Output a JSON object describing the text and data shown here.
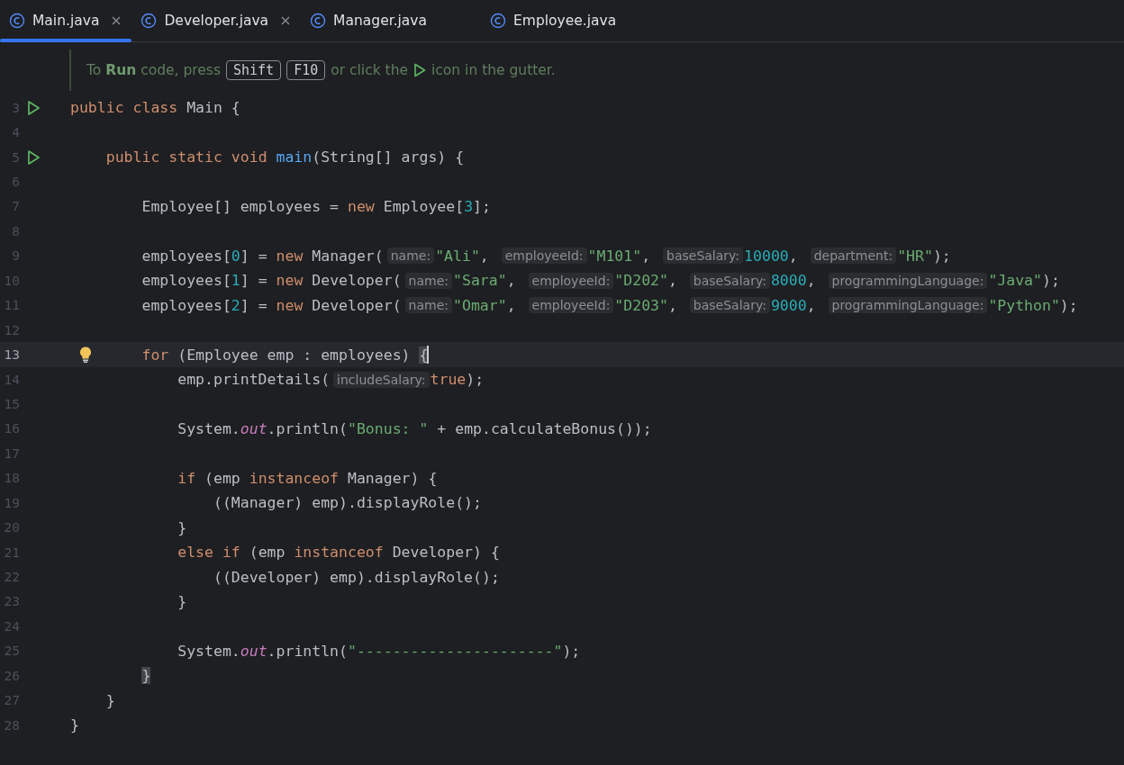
{
  "tabs": [
    {
      "label": "Main.java",
      "selected": true,
      "closable": true
    },
    {
      "label": "Developer.java",
      "selected": false,
      "closable": true
    },
    {
      "label": "Manager.java",
      "selected": false,
      "closable": false
    },
    {
      "label": "Employee.java",
      "selected": false,
      "closable": false
    }
  ],
  "run_hint": {
    "before": "To **Run** code, press",
    "keys": [
      "Shift",
      "F10"
    ],
    "middle": "or click the",
    "after": "icon in the gutter."
  },
  "lines": [
    {
      "number": "3",
      "kind": "run",
      "current": false,
      "segments": [
        {
          "kind": "keyword",
          "text": "public class"
        },
        {
          "kind": "plain",
          "text": " Main {"
        }
      ]
    },
    {
      "number": "4",
      "kind": "plain",
      "current": false
    },
    {
      "number": "5",
      "kind": "run",
      "current": false,
      "segments": [
        {
          "kind": "keyword",
          "text": "    public static void "
        },
        {
          "kind": "method",
          "text": "main"
        },
        {
          "kind": "plain",
          "text": "(String[] args) {"
        }
      ]
    },
    {
      "number": "6",
      "kind": "plain",
      "current": false
    },
    {
      "number": "7",
      "kind": "plain",
      "current": false,
      "segments": [
        {
          "kind": "plain",
          "text": "        Employee[] employees = "
        },
        {
          "kind": "keyword",
          "text": "new"
        },
        {
          "kind": "plain",
          "text": " Employee["
        },
        {
          "kind": "number",
          "text": "3"
        },
        {
          "kind": "plain",
          "text": "];"
        }
      ]
    },
    {
      "number": "8",
      "kind": "plain",
      "current": false
    },
    {
      "number": "9",
      "kind": "plain",
      "current": false,
      "segments": [
        {
          "kind": "plain",
          "text": "        employees["
        },
        {
          "kind": "number",
          "text": "0"
        },
        {
          "kind": "plain",
          "text": "] = "
        },
        {
          "kind": "keyword",
          "text": "new"
        },
        {
          "kind": "plain",
          "text": " Manager("
        },
        {
          "kind": "hint",
          "text": "name:"
        },
        {
          "kind": "string",
          "text": "\"Ali\""
        },
        {
          "kind": "plain",
          "text": ", "
        },
        {
          "kind": "hint",
          "text": "employeeId:"
        },
        {
          "kind": "string",
          "text": "\"M101\""
        },
        {
          "kind": "plain",
          "text": ", "
        },
        {
          "kind": "hint",
          "text": "baseSalary:"
        },
        {
          "kind": "number",
          "text": "10000"
        },
        {
          "kind": "plain",
          "text": ", "
        },
        {
          "kind": "hint",
          "text": "department:"
        },
        {
          "kind": "string",
          "text": "\"HR\""
        },
        {
          "kind": "plain",
          "text": ");"
        }
      ]
    },
    {
      "number": "10",
      "kind": "plain",
      "current": false,
      "segments": [
        {
          "kind": "plain",
          "text": "        employees["
        },
        {
          "kind": "number",
          "text": "1"
        },
        {
          "kind": "plain",
          "text": "] = "
        },
        {
          "kind": "keyword",
          "text": "new"
        },
        {
          "kind": "plain",
          "text": " Developer("
        },
        {
          "kind": "hint",
          "text": "name:"
        },
        {
          "kind": "string",
          "text": "\"Sara\""
        },
        {
          "kind": "plain",
          "text": ", "
        },
        {
          "kind": "hint",
          "text": "employeeId:"
        },
        {
          "kind": "string",
          "text": "\"D202\""
        },
        {
          "kind": "plain",
          "text": ", "
        },
        {
          "kind": "hint",
          "text": "baseSalary:"
        },
        {
          "kind": "number",
          "text": "8000"
        },
        {
          "kind": "plain",
          "text": ", "
        },
        {
          "kind": "hint",
          "text": "programmingLanguage:"
        },
        {
          "kind": "string",
          "text": "\"Java\""
        },
        {
          "kind": "plain",
          "text": ");"
        }
      ]
    },
    {
      "number": "11",
      "kind": "plain",
      "current": false,
      "segments": [
        {
          "kind": "plain",
          "text": "        employees["
        },
        {
          "kind": "number",
          "text": "2"
        },
        {
          "kind": "plain",
          "text": "] = "
        },
        {
          "kind": "keyword",
          "text": "new"
        },
        {
          "kind": "plain",
          "text": " Developer("
        },
        {
          "kind": "hint",
          "text": "name:"
        },
        {
          "kind": "string",
          "text": "\"Omar\""
        },
        {
          "kind": "plain",
          "text": ", "
        },
        {
          "kind": "hint",
          "text": "employeeId:"
        },
        {
          "kind": "string",
          "text": "\"D203\""
        },
        {
          "kind": "plain",
          "text": ", "
        },
        {
          "kind": "hint",
          "text": "baseSalary:"
        },
        {
          "kind": "number",
          "text": "9000"
        },
        {
          "kind": "plain",
          "text": ", "
        },
        {
          "kind": "hint",
          "text": "programmingLanguage:"
        },
        {
          "kind": "string",
          "text": "\"Python\""
        },
        {
          "kind": "plain",
          "text": ");"
        }
      ]
    },
    {
      "number": "12",
      "kind": "plain",
      "current": false
    },
    {
      "number": "13",
      "kind": "bulb",
      "current": true,
      "caret": true,
      "segments": [
        {
          "kind": "keyword",
          "text": "        for"
        },
        {
          "kind": "plain",
          "text": " (Employee emp : employees) "
        },
        {
          "kind": "brace",
          "text": "{"
        }
      ]
    },
    {
      "number": "14",
      "kind": "plain",
      "current": false,
      "segments": [
        {
          "kind": "plain",
          "text": "            emp.printDetails("
        },
        {
          "kind": "hint",
          "text": "includeSalary:"
        },
        {
          "kind": "keyword",
          "text": "true"
        },
        {
          "kind": "plain",
          "text": ");"
        }
      ]
    },
    {
      "number": "15",
      "kind": "plain",
      "current": false
    },
    {
      "number": "16",
      "kind": "plain",
      "current": false,
      "segments": [
        {
          "kind": "plain",
          "text": "            System."
        },
        {
          "kind": "field",
          "text": "out"
        },
        {
          "kind": "plain",
          "text": ".println("
        },
        {
          "kind": "string",
          "text": "\"Bonus: \""
        },
        {
          "kind": "plain",
          "text": " + emp.calculateBonus());"
        }
      ]
    },
    {
      "number": "17",
      "kind": "plain",
      "current": false
    },
    {
      "number": "18",
      "kind": "plain",
      "current": false,
      "segments": [
        {
          "kind": "keyword",
          "text": "            if"
        },
        {
          "kind": "plain",
          "text": " (emp "
        },
        {
          "kind": "keyword",
          "text": "instanceof"
        },
        {
          "kind": "plain",
          "text": " Manager) {"
        }
      ]
    },
    {
      "number": "19",
      "kind": "plain",
      "current": false,
      "segments": [
        {
          "kind": "plain",
          "text": "                ((Manager) emp).displayRole();"
        }
      ]
    },
    {
      "number": "20",
      "kind": "plain",
      "current": false,
      "segments": [
        {
          "kind": "plain",
          "text": "            }"
        }
      ]
    },
    {
      "number": "21",
      "kind": "plain",
      "current": false,
      "segments": [
        {
          "kind": "keyword",
          "text": "            else if"
        },
        {
          "kind": "plain",
          "text": " (emp "
        },
        {
          "kind": "keyword",
          "text": "instanceof"
        },
        {
          "kind": "plain",
          "text": " Developer) {"
        }
      ]
    },
    {
      "number": "22",
      "kind": "plain",
      "current": false,
      "segments": [
        {
          "kind": "plain",
          "text": "                ((Developer) emp).displayRole();"
        }
      ]
    },
    {
      "number": "23",
      "kind": "plain",
      "current": false,
      "segments": [
        {
          "kind": "plain",
          "text": "            }"
        }
      ]
    },
    {
      "number": "24",
      "kind": "plain",
      "current": false
    },
    {
      "number": "25",
      "kind": "plain",
      "current": false,
      "segments": [
        {
          "kind": "plain",
          "text": "            System."
        },
        {
          "kind": "field",
          "text": "out"
        },
        {
          "kind": "plain",
          "text": ".println("
        },
        {
          "kind": "string",
          "text": "\"----------------------\""
        },
        {
          "kind": "plain",
          "text": ");"
        }
      ]
    },
    {
      "number": "26",
      "kind": "plain",
      "current": false,
      "segments": [
        {
          "kind": "brace",
          "text": "        }"
        }
      ]
    },
    {
      "number": "27",
      "kind": "plain",
      "current": false,
      "segments": [
        {
          "kind": "plain",
          "text": "    }"
        }
      ]
    },
    {
      "number": "28",
      "kind": "plain",
      "current": false,
      "segments": [
        {
          "kind": "plain",
          "text": "}"
        }
      ]
    }
  ]
}
